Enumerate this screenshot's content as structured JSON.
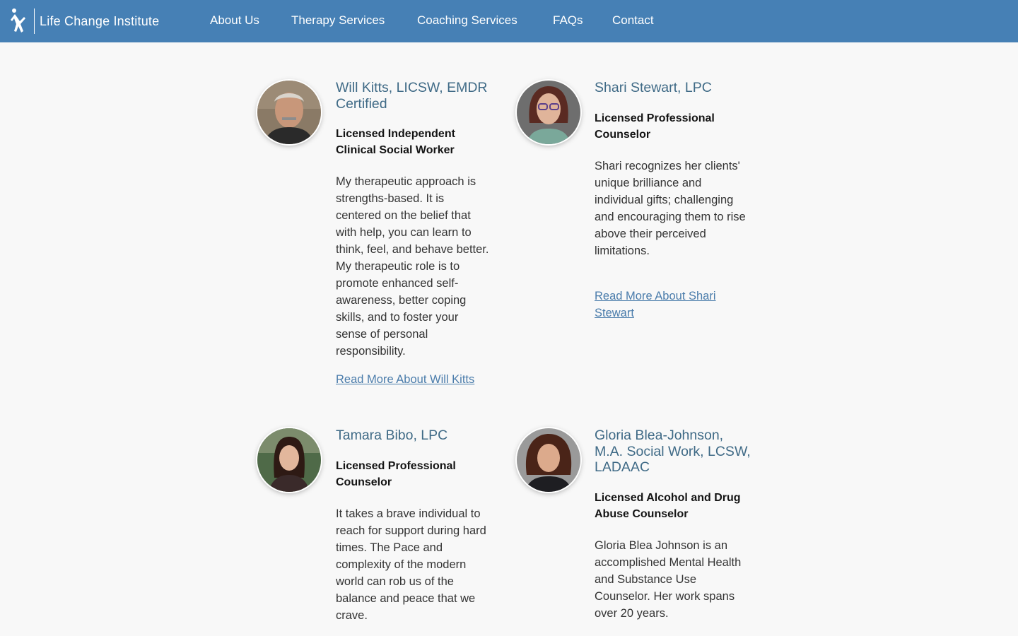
{
  "header": {
    "brand": "Life Change Institute",
    "brand_icon": "running-figure-icon",
    "nav": [
      {
        "label": "About Us"
      },
      {
        "label": "Therapy Services"
      },
      {
        "label": "Coaching Services"
      },
      {
        "label": "FAQs"
      },
      {
        "label": "Contact"
      }
    ],
    "background_color": "#4680b5"
  },
  "therapists": [
    {
      "name": "Will Kitts, LICSW, EMDR Certified",
      "credential": "Licensed Independent Clinical Social Worker",
      "bio": "My therapeutic approach is strengths-based. It is centered on the belief that with help, you can learn to think, feel, and behave better. My therapeutic role is to promote enhanced self-awareness, better coping skills, and to foster your sense of personal responsibility.",
      "link": "Read More About Will Kitts"
    },
    {
      "name": "Shari Stewart, LPC",
      "credential": "Licensed Professional Counselor",
      "bio": "Shari recognizes her clients' unique brilliance and individual gifts; challenging and encouraging them to rise above their perceived limitations.",
      "link": "Read More About Shari Stewart"
    },
    {
      "name": "Tamara Bibo, LPC",
      "credential": "Licensed Professional Counselor",
      "bio": "It takes a brave individual to reach for support during hard times. The Pace and complexity of the modern world can rob us of the balance and peace that we crave."
    },
    {
      "name": "Gloria Blea-Johnson, M.A. Social Work, LCSW, LADAAC",
      "credential": "Licensed Alcohol and Drug Abuse Counselor",
      "bio": "Gloria Blea Johnson is an accomplished Mental Health and Substance Use Counselor. Her work spans over 20 years."
    }
  ]
}
